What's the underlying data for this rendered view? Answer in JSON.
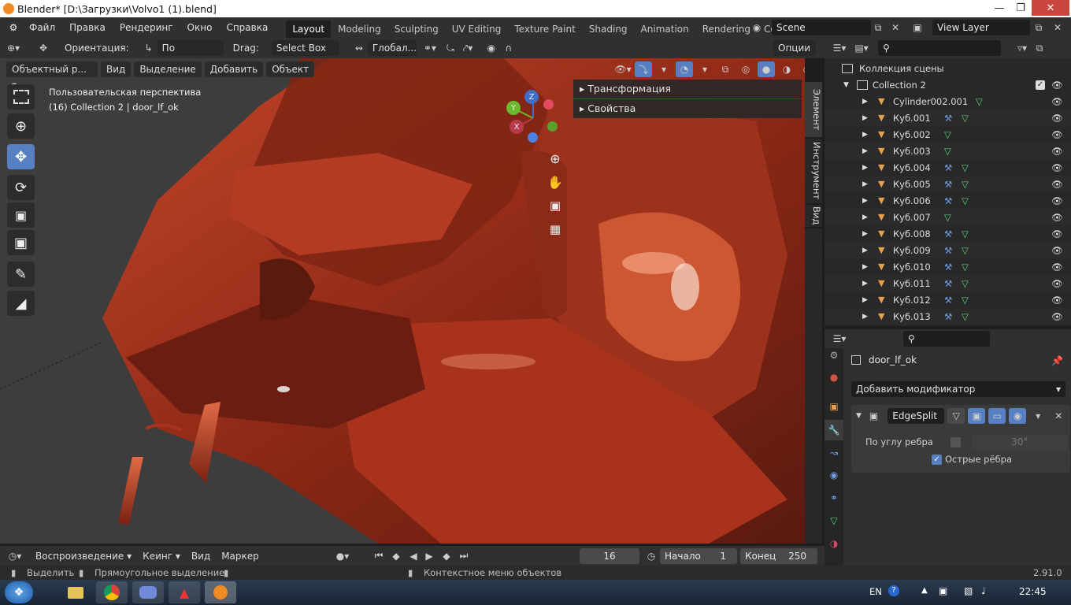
{
  "window": {
    "title": "Blender* [D:\\Загрузки\\Volvo1 (1).blend]"
  },
  "menu": [
    "Файл",
    "Правка",
    "Рендеринг",
    "Окно",
    "Справка"
  ],
  "workspaces": [
    "Layout",
    "Modeling",
    "Sculpting",
    "UV Editing",
    "Texture Paint",
    "Shading",
    "Animation",
    "Rendering",
    "Compositing"
  ],
  "scene": {
    "name": "Scene",
    "view_layer": "View Layer"
  },
  "header": {
    "orientation_label": "Ориентация:",
    "orientation_value": "По умолчан...",
    "drag_label": "Drag:",
    "drag_value": "Select Box",
    "transform_value": "Глобал...",
    "options": "Опции"
  },
  "viewport": {
    "mode": "Объектный р...",
    "menus": [
      "Вид",
      "Выделение",
      "Добавить",
      "Объект"
    ],
    "info_line1": "Пользовательская перспектива",
    "info_line2": "(16) Collection 2 | door_lf_ok",
    "panels": [
      "Трансформация",
      "Свойства"
    ],
    "side_tabs": [
      "Элемент",
      "Инструмент",
      "Вид"
    ],
    "gizmo": {
      "x": "X",
      "y": "Y",
      "z": "Z"
    }
  },
  "outliner": {
    "root": "Коллекция сцены",
    "collection": "Collection 2",
    "items": [
      {
        "name": "Cylinder002.001",
        "modifier": false
      },
      {
        "name": "Куб.001",
        "modifier": true
      },
      {
        "name": "Куб.002",
        "modifier": false
      },
      {
        "name": "Куб.003",
        "modifier": false
      },
      {
        "name": "Куб.004",
        "modifier": true
      },
      {
        "name": "Куб.005",
        "modifier": true
      },
      {
        "name": "Куб.006",
        "modifier": true
      },
      {
        "name": "Куб.007",
        "modifier": false
      },
      {
        "name": "Куб.008",
        "modifier": true
      },
      {
        "name": "Куб.009",
        "modifier": true
      },
      {
        "name": "Куб.010",
        "modifier": true
      },
      {
        "name": "Куб.011",
        "modifier": true
      },
      {
        "name": "Куб.012",
        "modifier": true
      },
      {
        "name": "Куб.013",
        "modifier": true
      }
    ]
  },
  "properties": {
    "object_name": "door_lf_ok",
    "add_modifier": "Добавить модификатор",
    "modifier_name": "EdgeSplit",
    "edge_angle_label": "По углу ребра",
    "edge_angle_value": "30°",
    "sharp_edges_label": "Острые рёбра",
    "sharp_edges_checked": true,
    "edge_angle_checked": false
  },
  "timeline": {
    "menus": [
      "Воспроизведение",
      "Кеинг",
      "Вид",
      "Маркер"
    ],
    "current_frame": "16",
    "start_label": "Начало",
    "start_value": "1",
    "end_label": "Конец",
    "end_value": "250"
  },
  "statusbar": {
    "select": "Выделить",
    "box_select": "Прямоугольное выделение",
    "context_menu": "Контекстное меню объектов",
    "version": "2.91.0"
  },
  "taskbar": {
    "lang": "EN",
    "time": "22:45"
  },
  "colors": {
    "accent": "#5680c2",
    "object_orange": "#e8a04a",
    "mesh_green": "#5fd27a",
    "wrench_blue": "#6e9ce0",
    "model_red": "#a8321c"
  }
}
